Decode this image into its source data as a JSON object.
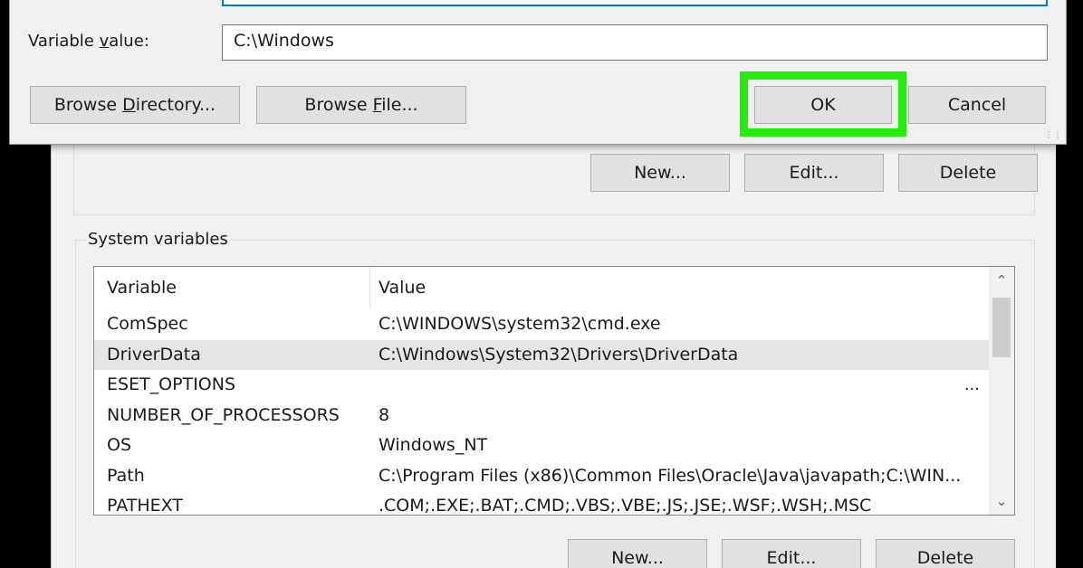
{
  "user_variables": {
    "buttons": {
      "new": "New...",
      "edit": "Edit...",
      "delete": "Delete"
    }
  },
  "system_variables": {
    "group_label": "System variables",
    "columns": {
      "variable": "Variable",
      "value": "Value"
    },
    "rows": [
      {
        "variable": "ComSpec",
        "value": "C:\\WINDOWS\\system32\\cmd.exe"
      },
      {
        "variable": "DriverData",
        "value": "C:\\Windows\\System32\\Drivers\\DriverData"
      },
      {
        "variable": "ESET_OPTIONS",
        "value": "",
        "trailing": "..."
      },
      {
        "variable": "NUMBER_OF_PROCESSORS",
        "value": "8"
      },
      {
        "variable": "OS",
        "value": "Windows_NT"
      },
      {
        "variable": "Path",
        "value": "C:\\Program Files (x86)\\Common Files\\Oracle\\Java\\javapath;C:\\WIN..."
      },
      {
        "variable": "PATHEXT",
        "value": ".COM;.EXE;.BAT;.CMD;.VBS;.VBE;.JS;.JSE;.WSF;.WSH;.MSC"
      }
    ],
    "selected_row": "DriverData",
    "buttons": {
      "new": "New...",
      "edit": "Edit...",
      "delete": "Delete"
    }
  },
  "edit_dialog": {
    "variable_value_label_pre": "Variable ",
    "variable_value_label_accel": "v",
    "variable_value_label_post": "alue:",
    "variable_value": "C:\\Windows",
    "browse_directory_pre": "Browse ",
    "browse_directory_accel": "D",
    "browse_directory_post": "irectory...",
    "browse_file_pre": "Browse ",
    "browse_file_accel": "F",
    "browse_file_post": "ile...",
    "ok_label": "OK",
    "cancel_label": "Cancel",
    "highlight_color": "#22ee0a"
  }
}
